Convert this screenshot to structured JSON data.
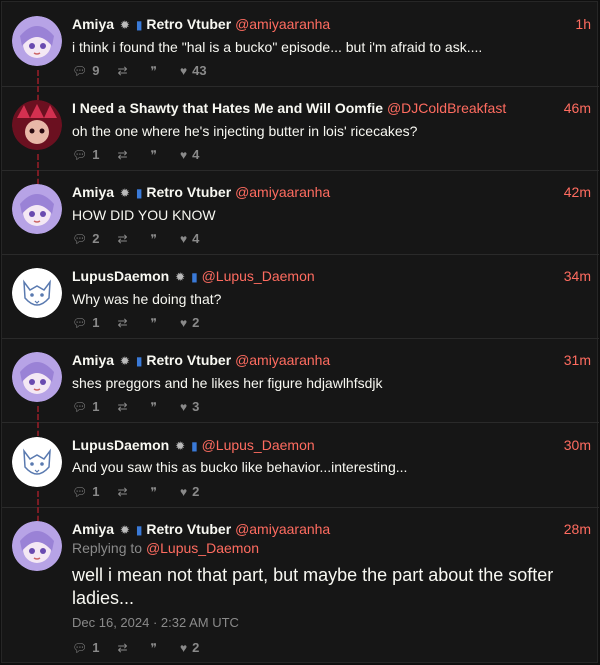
{
  "colors": {
    "accent": "#ff6c60",
    "background": "#161616",
    "text": "#f8f8f2",
    "muted": "#8a8a8a",
    "thread_line": "#7a1c24"
  },
  "tweets": [
    {
      "name": "Amiya",
      "badges": [
        "gear-badge",
        "spool-badge"
      ],
      "name_suffix": "Retro Vtuber",
      "handle": "@amiyaaranha",
      "time": "1h",
      "text": "i think i found the \"hal is a bucko\" episode... but i'm afraid to ask....",
      "replies": "9",
      "retweets": "",
      "quotes": "",
      "likes": "43"
    },
    {
      "name": "I Need a Shawty that Hates Me and Will Oomfie",
      "badges": [],
      "name_suffix": "",
      "handle": "@DJColdBreakfast",
      "time": "46m",
      "text": "oh the one where he's injecting butter in lois' ricecakes?",
      "replies": "1",
      "retweets": "",
      "quotes": "",
      "likes": "4"
    },
    {
      "name": "Amiya",
      "badges": [
        "gear-badge",
        "spool-badge"
      ],
      "name_suffix": "Retro Vtuber",
      "handle": "@amiyaaranha",
      "time": "42m",
      "text": "HOW DID YOU KNOW",
      "replies": "2",
      "retweets": "",
      "quotes": "",
      "likes": "4"
    },
    {
      "name": "LupusDaemon",
      "badges": [
        "gear-badge",
        "spool-badge"
      ],
      "name_suffix": "",
      "handle": "@Lupus_Daemon",
      "time": "34m",
      "text": "Why was he doing that?",
      "replies": "1",
      "retweets": "",
      "quotes": "",
      "likes": "2"
    },
    {
      "name": "Amiya",
      "badges": [
        "gear-badge",
        "spool-badge"
      ],
      "name_suffix": "Retro Vtuber",
      "handle": "@amiyaaranha",
      "time": "31m",
      "text": "shes preggors and he likes her figure hdjawlhfsdjk",
      "replies": "1",
      "retweets": "",
      "quotes": "",
      "likes": "3"
    },
    {
      "name": "LupusDaemon",
      "badges": [
        "gear-badge",
        "spool-badge"
      ],
      "name_suffix": "",
      "handle": "@Lupus_Daemon",
      "time": "30m",
      "text": "And you saw this as bucko like behavior...interesting...",
      "replies": "1",
      "retweets": "",
      "quotes": "",
      "likes": "2"
    }
  ],
  "main_tweet": {
    "name": "Amiya",
    "name_suffix": "Retro Vtuber",
    "handle": "@amiyaaranha",
    "time": "28m",
    "replying_label": "Replying to",
    "replying_handle": "@Lupus_Daemon",
    "text": "well i mean not that part, but maybe the part about the softer ladies...",
    "date": "Dec 16, 2024 · 2:32 AM UTC",
    "replies": "1",
    "retweets": "",
    "quotes": "",
    "likes": "2"
  }
}
